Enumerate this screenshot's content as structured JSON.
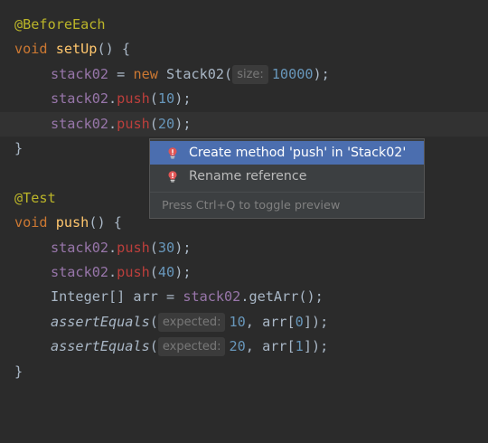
{
  "code": {
    "line1_annotation": "@BeforeEach",
    "line2": {
      "kw": "void",
      "method": "setUp",
      "rest": "() {"
    },
    "line3": {
      "field": "stack02",
      "eq": " = ",
      "kw": "new",
      "cls": " Stack02(",
      "hint": "size:",
      "num": "10000",
      "end": ");"
    },
    "line4": {
      "field": "stack02",
      "dot": ".",
      "call": "push",
      "open": "(",
      "num": "10",
      "end": ");"
    },
    "line5": {
      "field": "stack02",
      "dot": ".",
      "call": "push",
      "open": "(",
      "num": "20",
      "end": ");"
    },
    "line6_brace": "}",
    "line8_annotation": "@Test",
    "line9": {
      "kw": "void",
      "method": "push",
      "rest": "() {"
    },
    "line10": {
      "field": "stack02",
      "dot": ".",
      "call": "push",
      "open": "(",
      "num": "30",
      "end": ");"
    },
    "line11": {
      "field": "stack02",
      "dot": ".",
      "call": "push",
      "open": "(",
      "num": "40",
      "end": ");"
    },
    "line12": {
      "type": "Integer[] arr = ",
      "field": "stack02",
      "rest": ".getArr();"
    },
    "line13": {
      "call": "assertEquals",
      "open": "(",
      "hint": "expected:",
      "num": "10",
      "mid": ", arr[",
      "idx": "0",
      "end": "]);"
    },
    "line14": {
      "call": "assertEquals",
      "open": "(",
      "hint": "expected:",
      "num": "20",
      "mid": ", arr[",
      "idx": "1",
      "end": "]);"
    },
    "line15_brace": "}"
  },
  "popup": {
    "items": [
      {
        "label": "Create method 'push' in 'Stack02'",
        "icon": "error-bulb-icon",
        "selected": true
      },
      {
        "label": "Rename reference",
        "icon": "error-bulb-icon",
        "selected": false
      }
    ],
    "footer_hint": "Press Ctrl+Q to toggle preview"
  },
  "colors": {
    "background": "#2b2b2b",
    "keyword": "#cc7832",
    "annotation": "#bbb529",
    "method": "#ffc66d",
    "field": "#9876aa",
    "number": "#6897bb",
    "error": "#bc3f3c",
    "selection": "#4b6eaf"
  }
}
